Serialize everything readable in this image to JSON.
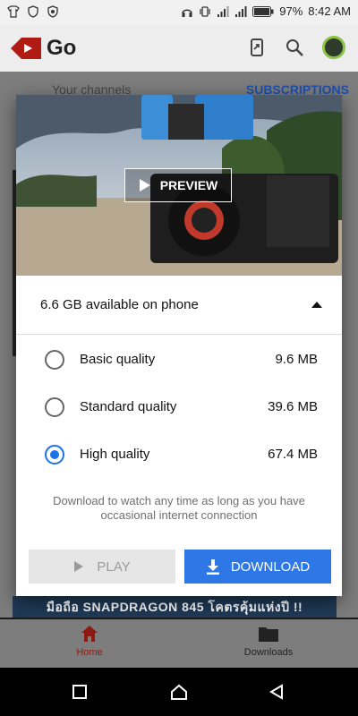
{
  "status_bar": {
    "battery": "97%",
    "time": "8:42 AM"
  },
  "app": {
    "name": "Go"
  },
  "channels_bar": {
    "left_label": "Your channels",
    "right_label": "SUBSCRIPTIONS"
  },
  "dialog": {
    "preview_label": "PREVIEW",
    "storage_text": "6.6 GB available on phone",
    "options": [
      {
        "label": "Basic quality",
        "size": "9.6 MB",
        "selected": false
      },
      {
        "label": "Standard quality",
        "size": "39.6 MB",
        "selected": false
      },
      {
        "label": "High quality",
        "size": "67.4 MB",
        "selected": true
      }
    ],
    "note": "Download to watch any time as long as you have occasional internet connection",
    "play_label": "PLAY",
    "download_label": "DOWNLOAD"
  },
  "background_video_title": "มือถือ SNAPDRAGON 845 โคตรคุ้มแห่งปี !!",
  "bottom_nav": {
    "home_label": "Home",
    "downloads_label": "Downloads"
  },
  "colors": {
    "accent_blue": "#2d78e6",
    "brand_red": "#e62117",
    "scrim": "#7d7d7d"
  }
}
